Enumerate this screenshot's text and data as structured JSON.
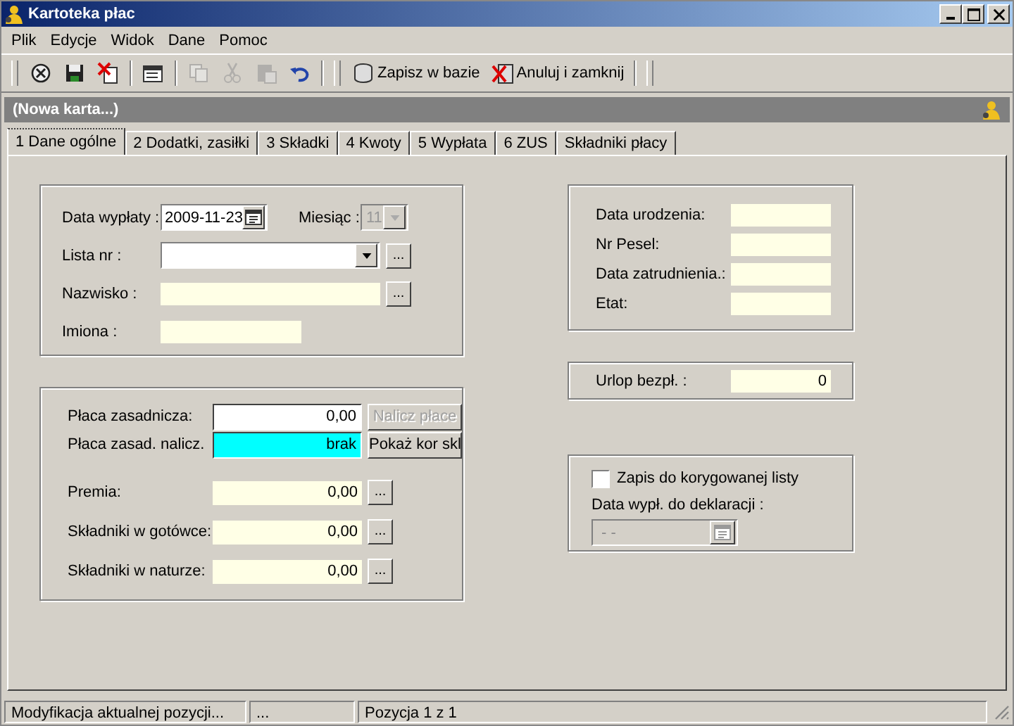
{
  "window": {
    "title": "Kartoteka płac"
  },
  "menu": [
    {
      "label": "Plik"
    },
    {
      "label": "Edycje"
    },
    {
      "label": "Widok"
    },
    {
      "label": "Dane"
    },
    {
      "label": "Pomoc"
    }
  ],
  "toolbar": {
    "tools": [
      {
        "kind": "refresh",
        "disabled": false
      },
      {
        "kind": "save",
        "disabled": false
      },
      {
        "kind": "delete",
        "disabled": false
      },
      {
        "kind": "properties",
        "disabled": false
      },
      {
        "kind": "copy",
        "disabled": true
      },
      {
        "kind": "cut",
        "disabled": true
      },
      {
        "kind": "paste",
        "disabled": true
      },
      {
        "kind": "undo",
        "disabled": false
      }
    ],
    "buttons": [
      {
        "label": "Zapisz w bazie",
        "kind": "save-db"
      },
      {
        "label": "Anuluj i zamknij",
        "kind": "cancel"
      }
    ]
  },
  "record_header": {
    "title": "(Nowa karta...)"
  },
  "tabs": [
    {
      "label": "1 Dane ogólne",
      "selected": true
    },
    {
      "label": "2 Dodatki, zasiłki",
      "selected": false
    },
    {
      "label": "3 Składki",
      "selected": false
    },
    {
      "label": "4 Kwoty",
      "selected": false
    },
    {
      "label": "5 Wypłata",
      "selected": false
    },
    {
      "label": "6 ZUS",
      "selected": false
    },
    {
      "label": "Składniki płacy",
      "selected": false
    }
  ],
  "general": {
    "date_label": "Data wypłaty :",
    "date_value": "2009-11-23",
    "month_label": "Miesiąc :",
    "month_value": "11",
    "month_disabled": true,
    "list_label": "Lista nr :",
    "list_button": "...",
    "surname_label": "Nazwisko :",
    "surname_button": "...",
    "names_label": "Imiona :"
  },
  "pay": {
    "base_label": "Płaca zasadnicza:",
    "base_value": "0,00",
    "calc_button": {
      "label": "Nalicz płace",
      "disabled": true
    },
    "calc_label": "Płaca zasad. nalicz.",
    "calc_value": "brak",
    "show_button": {
      "label": "Pokaż kor skl",
      "disabled": false
    },
    "rows": [
      {
        "label": "Premia:",
        "value": "0,00",
        "button": "..."
      },
      {
        "label": "Składniki w gotówce:",
        "value": "0,00",
        "button": "..."
      },
      {
        "label": "Składniki w naturze:",
        "value": "0,00",
        "button": "..."
      }
    ]
  },
  "personal": [
    {
      "label": "Data urodzenia:"
    },
    {
      "label": "Nr Pesel:"
    },
    {
      "label": "Data zatrudnienia.:"
    },
    {
      "label": "Etat:"
    }
  ],
  "leave": {
    "label": "Urlop bezpł. :",
    "value": "0"
  },
  "correction": {
    "checkbox_label": "Zapis do korygowanej listy",
    "checked": false,
    "date_label": "Data wypł. do deklaracji :",
    "date_value": "- -",
    "date_disabled": true
  },
  "status_bar": [
    {
      "text": "Modyfikacja aktualnej pozycji..."
    },
    {
      "text": "..."
    },
    {
      "text": "Pozycja 1 z 1"
    }
  ]
}
